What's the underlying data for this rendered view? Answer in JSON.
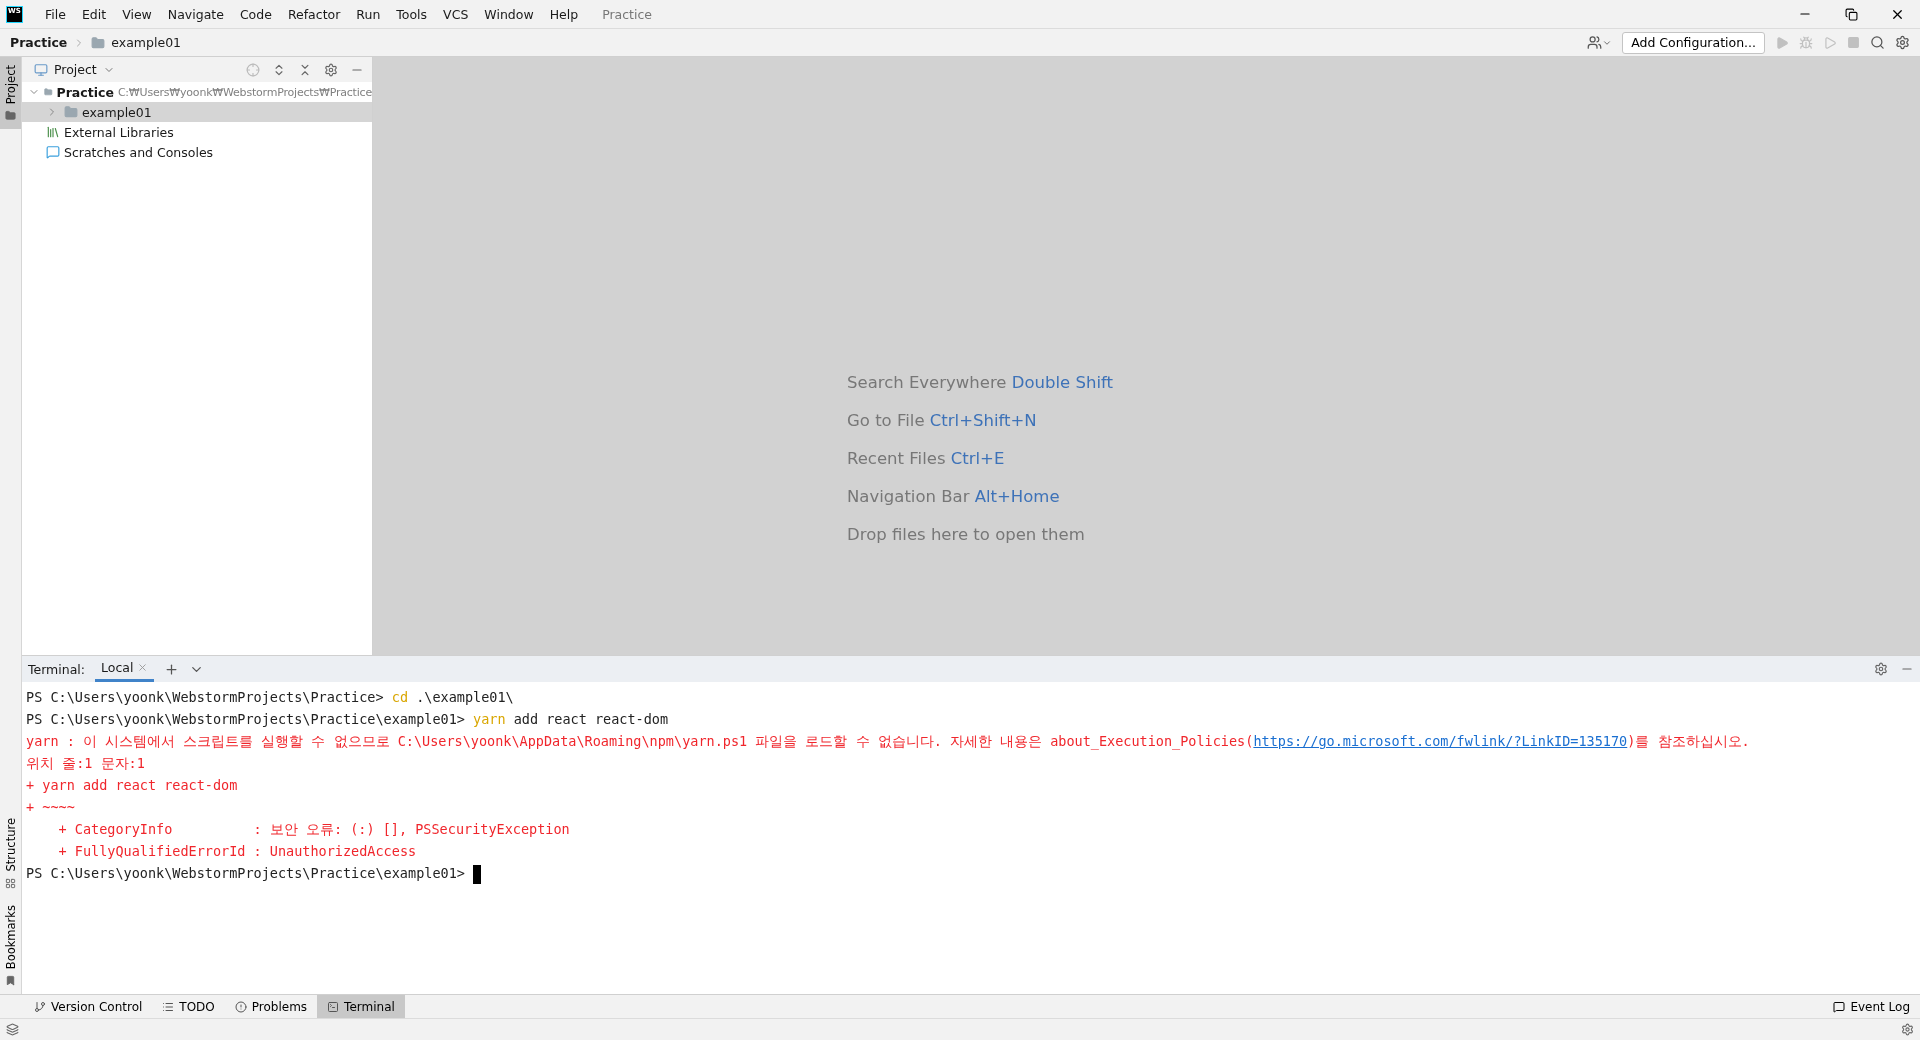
{
  "window": {
    "title": "Practice",
    "logo_text": "WS"
  },
  "menu": [
    "File",
    "Edit",
    "View",
    "Navigate",
    "Code",
    "Refactor",
    "Run",
    "Tools",
    "VCS",
    "Window",
    "Help"
  ],
  "breadcrumbs": [
    {
      "label": "Practice",
      "kind": "project"
    },
    {
      "label": "example01",
      "kind": "folder"
    }
  ],
  "toolbar": {
    "run_config": "Add Configuration..."
  },
  "side_stripe_top": [
    {
      "label": "Project",
      "selected": true
    }
  ],
  "side_stripe_bottom": [
    {
      "label": "Structure",
      "selected": false
    },
    {
      "label": "Bookmarks",
      "selected": false
    }
  ],
  "project_panel": {
    "title": "Project",
    "tree": [
      {
        "label": "Practice",
        "hint": "C:₩Users₩yoonk₩WebstormProjects₩Practice",
        "kind": "folder",
        "expanded": true,
        "selected": false,
        "children": [
          {
            "label": "example01",
            "kind": "folder",
            "expanded": false,
            "selected": true
          }
        ]
      },
      {
        "label": "External Libraries",
        "kind": "libraries",
        "selected": false
      },
      {
        "label": "Scratches and Consoles",
        "kind": "scratches",
        "selected": false
      }
    ]
  },
  "editor_hints": [
    {
      "text": "Search Everywhere",
      "shortcut": "Double Shift"
    },
    {
      "text": "Go to File",
      "shortcut": "Ctrl+Shift+N"
    },
    {
      "text": "Recent Files",
      "shortcut": "Ctrl+E"
    },
    {
      "text": "Navigation Bar",
      "shortcut": "Alt+Home"
    },
    {
      "text": "Drop files here to open them"
    }
  ],
  "terminal": {
    "label": "Terminal:",
    "tabs": [
      {
        "label": "Local",
        "selected": true
      }
    ],
    "lines": [
      [
        {
          "kind": "plain",
          "text": "PS C:\\Users\\yoonk\\WebstormProjects\\Practice> "
        },
        {
          "kind": "command",
          "text": "cd"
        },
        {
          "kind": "plain",
          "text": " .\\example01\\"
        }
      ],
      [
        {
          "kind": "plain",
          "text": "PS C:\\Users\\yoonk\\WebstormProjects\\Practice\\example01> "
        },
        {
          "kind": "command",
          "text": "yarn"
        },
        {
          "kind": "plain",
          "text": " add react react-dom"
        }
      ],
      [
        {
          "kind": "error",
          "text": "yarn : 이 시스템에서 스크립트를 실행할 수 없으므로 C:\\Users\\yoonk\\AppData\\Roaming\\npm\\yarn.ps1 파일을 로드할 수 없습니다. 자세한 내용은 about_Execution_Policies("
        },
        {
          "kind": "link",
          "text": "https://go.microsoft.com/fwlink/?LinkID=135170"
        },
        {
          "kind": "error",
          "text": ")를 참조하십시오."
        }
      ],
      [
        {
          "kind": "error",
          "text": "위치 줄:1 문자:1"
        }
      ],
      [
        {
          "kind": "error",
          "text": "+ yarn add react react-dom"
        }
      ],
      [
        {
          "kind": "error",
          "text": "+ ~~~~"
        }
      ],
      [
        {
          "kind": "error",
          "text": "    + CategoryInfo          : 보안 오류: (:) [], PSSecurityException"
        }
      ],
      [
        {
          "kind": "error",
          "text": "    + FullyQualifiedErrorId : UnauthorizedAccess"
        }
      ],
      [
        {
          "kind": "plain",
          "text": "PS C:\\Users\\yoonk\\WebstormProjects\\Practice\\example01> "
        },
        {
          "kind": "cursor"
        }
      ]
    ]
  },
  "tool_tabs": [
    {
      "label": "Version Control",
      "kind": "vcs",
      "selected": false
    },
    {
      "label": "TODO",
      "kind": "todo",
      "selected": false
    },
    {
      "label": "Problems",
      "kind": "problems",
      "selected": false
    },
    {
      "label": "Terminal",
      "kind": "terminal",
      "selected": true
    }
  ],
  "event_log": "Event Log"
}
